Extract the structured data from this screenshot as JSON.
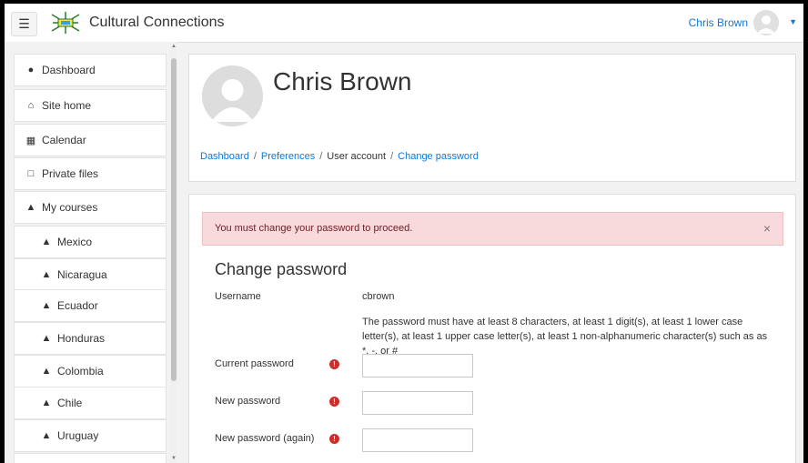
{
  "navbar": {
    "site_name": "Cultural Connections",
    "user_name": "Chris Brown"
  },
  "drawer": {
    "items": [
      {
        "label": "Dashboard",
        "icon": "dashboard-icon",
        "level": "main"
      },
      {
        "label": "Site home",
        "icon": "home-icon",
        "level": "main"
      },
      {
        "label": "Calendar",
        "icon": "calendar-icon",
        "level": "main"
      },
      {
        "label": "Private files",
        "icon": "file-icon",
        "level": "main"
      },
      {
        "label": "My courses",
        "icon": "graduation-cap-icon",
        "level": "main"
      },
      {
        "label": "Mexico",
        "icon": "graduation-cap-icon",
        "level": "sub"
      },
      {
        "label": "Nicaragua",
        "icon": "graduation-cap-icon",
        "level": "sub"
      },
      {
        "label": "Ecuador",
        "icon": "graduation-cap-icon",
        "level": "sub"
      },
      {
        "label": "Honduras",
        "icon": "graduation-cap-icon",
        "level": "sub"
      },
      {
        "label": "Colombia",
        "icon": "graduation-cap-icon",
        "level": "sub"
      },
      {
        "label": "Chile",
        "icon": "graduation-cap-icon",
        "level": "sub"
      },
      {
        "label": "Uruguay",
        "icon": "graduation-cap-icon",
        "level": "sub"
      }
    ]
  },
  "header": {
    "full_name": "Chris Brown",
    "breadcrumb": [
      "Dashboard",
      "Preferences",
      "User account",
      "Change password"
    ]
  },
  "alert": {
    "message": "You must change your password to proceed.",
    "close": "×"
  },
  "form": {
    "title": "Change password",
    "username_label": "Username",
    "username_value": "cbrown",
    "rules": "The password must have at least 8 characters, at least 1 digit(s), at least 1 lower case letter(s), at least 1 upper case letter(s), at least 1 non-alphanumeric character(s) such as as *, -, or #",
    "current_label": "Current password",
    "new_label": "New password",
    "new_again_label": "New password (again)",
    "current_value": "",
    "new_value": "",
    "new_again_value": ""
  },
  "colors": {
    "link": "#1177d1",
    "alert_bg": "#f8d9dc",
    "alert_text": "#6c1c24",
    "required": "#c9302c"
  }
}
